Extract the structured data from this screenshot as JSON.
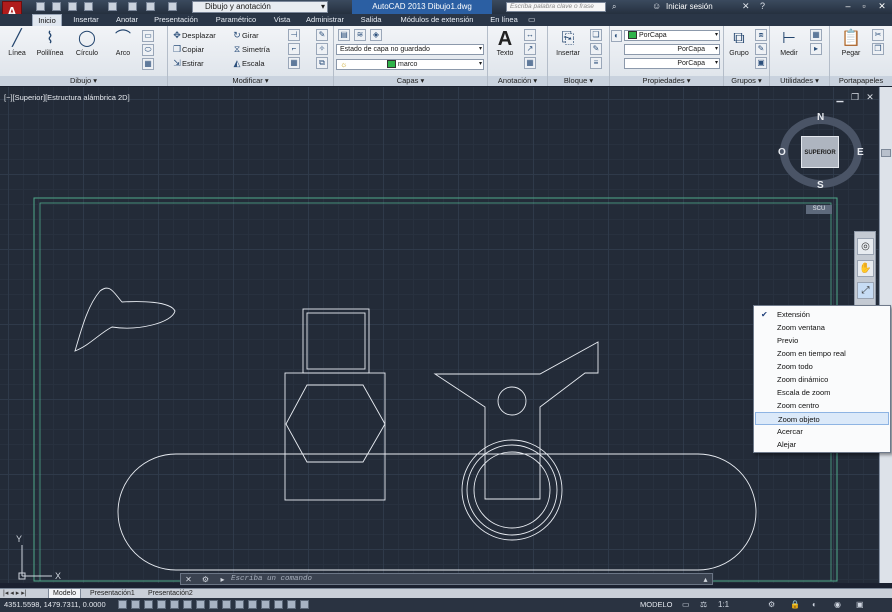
{
  "app": {
    "logo": "A",
    "workspace": "Dibujo y anotación",
    "title": "AutoCAD 2013    Dibujo1.dwg",
    "search_placeholder": "Escriba palabra clave o frase",
    "login": "Iniciar sesión"
  },
  "tabs": [
    "Inicio",
    "Insertar",
    "Anotar",
    "Presentación",
    "Paramétrico",
    "Vista",
    "Administrar",
    "Salida",
    "Módulos de extensión",
    "En línea"
  ],
  "ribbon": {
    "dibujo": {
      "label": "Dibujo",
      "buttons": [
        "Línea",
        "Polilínea",
        "Círculo",
        "Arco"
      ]
    },
    "modificar": {
      "label": "Modificar",
      "buttons": [
        "Desplazar",
        "Girar",
        "Copiar",
        "Simetría",
        "Estirar",
        "Escala"
      ]
    },
    "capas": {
      "label": "Capas",
      "layer_state": "Estado de capa no guardado",
      "current_layer": "marco",
      "current_layer_color": "#2fb34a"
    },
    "anotacion": {
      "label": "Anotación",
      "button": "Texto"
    },
    "bloque": {
      "label": "Bloque",
      "button": "Insertar"
    },
    "propiedades": {
      "label": "Propiedades",
      "color": "PorCapa",
      "linetype": "PorCapa",
      "lineweight": "PorCapa"
    },
    "grupos": {
      "label": "Grupos",
      "button": "Grupo"
    },
    "utilidades": {
      "label": "Utilidades",
      "button": "Medir"
    },
    "portapapeles": {
      "label": "Portapapeles",
      "button": "Pegar"
    }
  },
  "viewport": {
    "label": "[−][Superior][Estructura alámbrica 2D]",
    "viewcube_face": "SUPERIOR",
    "compass": {
      "n": "N",
      "s": "S",
      "e": "E",
      "o": "O"
    },
    "wcs": "SCU",
    "ucs_y": "Y",
    "ucs_x": "X"
  },
  "zoom_menu": {
    "items": [
      "Extensión",
      "Zoom ventana",
      "Previo",
      "Zoom en tiempo real",
      "Zoom todo",
      "Zoom dinámico",
      "Escala de zoom",
      "Zoom centro",
      "Zoom objeto",
      "Acercar",
      "Alejar"
    ],
    "checked": "Extensión",
    "highlighted": "Zoom objeto"
  },
  "command_line": {
    "placeholder": "Escriba un comando"
  },
  "layout_tabs": [
    "Modelo",
    "Presentación1",
    "Presentación2"
  ],
  "status": {
    "coordinates": "4351.5598, 1479.7311, 0.0000",
    "space": "MODELO",
    "scale": "1:1"
  }
}
